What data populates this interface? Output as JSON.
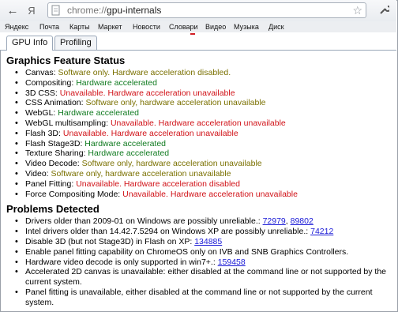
{
  "browser": {
    "url_scheme": "chrome://",
    "url_path": "gpu-internals",
    "bookmarks": [
      "Яндекс",
      "Почта",
      "Карты",
      "Маркет",
      "Новости",
      "Словари",
      "Видео",
      "Музыка",
      "Диск"
    ]
  },
  "tabs": [
    "GPU Info",
    "Profiling"
  ],
  "sections": {
    "features_title": "Graphics Feature Status",
    "features": [
      {
        "label": "Canvas:",
        "status": "Software only. Hardware acceleration disabled.",
        "color": "#7a7000"
      },
      {
        "label": "Compositing:",
        "status": "Hardware accelerated",
        "color": "#0f7a1f"
      },
      {
        "label": "3D CSS:",
        "status": "Unavailable. Hardware acceleration unavailable",
        "color": "#d01016"
      },
      {
        "label": "CSS Animation:",
        "status": "Software only, hardware acceleration unavailable",
        "color": "#7a7000"
      },
      {
        "label": "WebGL:",
        "status": "Hardware accelerated",
        "color": "#0f7a1f"
      },
      {
        "label": "WebGL multisampling:",
        "status": "Unavailable. Hardware acceleration unavailable",
        "color": "#d01016"
      },
      {
        "label": "Flash 3D:",
        "status": "Unavailable. Hardware acceleration unavailable",
        "color": "#d01016"
      },
      {
        "label": "Flash Stage3D:",
        "status": "Hardware accelerated",
        "color": "#0f7a1f"
      },
      {
        "label": "Texture Sharing:",
        "status": "Hardware accelerated",
        "color": "#0f7a1f"
      },
      {
        "label": "Video Decode:",
        "status": "Software only, hardware acceleration unavailable",
        "color": "#7a7000"
      },
      {
        "label": "Video:",
        "status": "Software only, hardware acceleration unavailable",
        "color": "#7a7000"
      },
      {
        "label": "Panel Fitting:",
        "status": "Unavailable. Hardware acceleration disabled",
        "color": "#d01016"
      },
      {
        "label": "Force Compositing Mode:",
        "status": "Unavailable. Hardware acceleration unavailable",
        "color": "#d01016"
      }
    ],
    "problems_title": "Problems Detected",
    "problems": [
      {
        "text": "Drivers older than 2009-01 on Windows are possibly unreliable.: ",
        "links": [
          "72979",
          "89802"
        ]
      },
      {
        "text": "Intel drivers older than 14.42.7.5294 on Windows XP are possibly unreliable.: ",
        "links": [
          "74212"
        ]
      },
      {
        "text": "Disable 3D (but not Stage3D) in Flash on XP: ",
        "links": [
          "134885"
        ]
      },
      {
        "text": "Enable panel fitting capability on ChromeOS only on IVB and SNB Graphics Controllers.",
        "links": []
      },
      {
        "text": "Hardware video decode is only supported in win7+.: ",
        "links": [
          "159458"
        ]
      },
      {
        "text": "Accelerated 2D canvas is unavailable: either disabled at the command line or not supported by the current system.",
        "links": []
      },
      {
        "text": "Panel fitting is unavailable, either disabled at the command line or not supported by the current system.",
        "links": []
      }
    ]
  }
}
